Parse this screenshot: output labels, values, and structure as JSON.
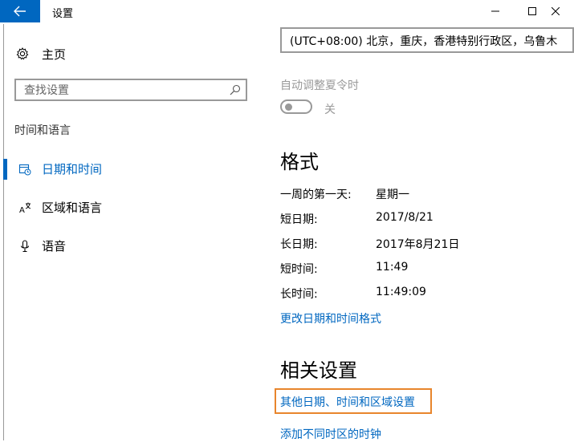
{
  "window": {
    "title": "设置",
    "back_icon": "arrow-left-icon",
    "minimize_icon": "minimize-icon",
    "maximize_icon": "maximize-icon",
    "close_icon": "close-icon"
  },
  "sidebar": {
    "home_label": "主页",
    "home_icon": "gear-icon",
    "search_placeholder": "查找设置",
    "search_icon": "search-icon",
    "section_label": "时间和语言",
    "items": [
      {
        "label": "日期和时间",
        "icon": "date-time-icon",
        "active": true
      },
      {
        "label": "区域和语言",
        "icon": "region-language-icon",
        "active": false
      },
      {
        "label": "语音",
        "icon": "microphone-icon",
        "active": false
      }
    ]
  },
  "main": {
    "timezone_value": "(UTC+08:00) 北京，重庆，香港特别行政区，乌鲁木",
    "dst_label": "自动调整夏令时",
    "dst_toggle_state": "关",
    "format_heading": "格式",
    "formats": [
      {
        "key": "一周的第一天:",
        "value": "星期一"
      },
      {
        "key": "短日期:",
        "value": "2017/8/21"
      },
      {
        "key": "长日期:",
        "value": "2017年8月21日"
      },
      {
        "key": "短时间:",
        "value": "11:49"
      },
      {
        "key": "长时间:",
        "value": "11:49:09"
      }
    ],
    "change_format_link": "更改日期和时间格式",
    "related_heading": "相关设置",
    "related_links": [
      "其他日期、时间和区域设置",
      "添加不同时区的时钟"
    ]
  },
  "colors": {
    "accent": "#0067c0",
    "highlight": "#e8852c"
  }
}
